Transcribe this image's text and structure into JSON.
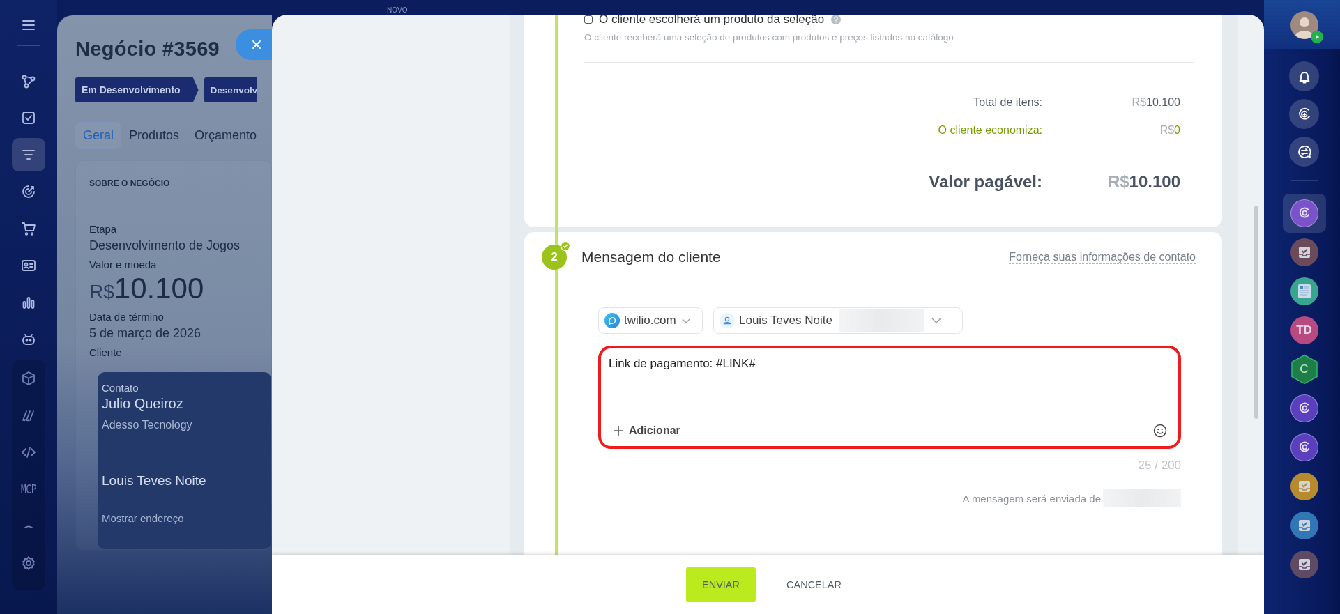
{
  "top_bar": {
    "label": "NOVO"
  },
  "left_nav": {
    "items": [
      {
        "kind": "icon",
        "selected": false
      },
      {
        "kind": "icon",
        "selected": false
      },
      {
        "kind": "icon",
        "selected": true
      },
      {
        "kind": "icon",
        "selected": false
      },
      {
        "kind": "icon",
        "selected": false
      },
      {
        "kind": "icon",
        "selected": false
      },
      {
        "kind": "icon",
        "selected": false
      },
      {
        "kind": "icon",
        "selected": false
      },
      {
        "kind": "icon",
        "selected": false
      },
      {
        "kind": "icon",
        "selected": false
      },
      {
        "kind": "icon",
        "selected": false
      },
      {
        "kind": "text",
        "label": "MCP",
        "selected": false
      },
      {
        "kind": "icon",
        "selected": false
      },
      {
        "kind": "icon",
        "selected": false
      }
    ]
  },
  "deal": {
    "title": "Negócio #3569",
    "stages": [
      "Em Desenvolvimento",
      "Desenvolv"
    ],
    "tabs": [
      {
        "label": "Geral",
        "selected": true
      },
      {
        "label": "Produtos",
        "selected": false
      },
      {
        "label": "Orçamento",
        "selected": false
      }
    ],
    "section_title": "SOBRE O NEGÓCIO",
    "fields": [
      {
        "kind": "text",
        "label": "Etapa",
        "value": "Desenvolvimento de Jogos"
      },
      {
        "kind": "money",
        "label": "Valor e moeda",
        "currency": "R$",
        "value": "10.100"
      },
      {
        "kind": "text",
        "label": "Data de término",
        "value": "5 de março de 2026"
      }
    ],
    "client_label": "Cliente",
    "contact": {
      "label": "Contato",
      "name": "Julio Queiroz",
      "company": "Adesso Tecnology",
      "second_name": "Louis Teves Noite",
      "address_link": "Mostrar endereço"
    }
  },
  "selection_option": {
    "label": "O cliente escolherá um produto da seleção",
    "checked": false,
    "description": "O cliente receberá uma seleção de produtos com produtos e preços listados no catálogo"
  },
  "totals": [
    {
      "kind": "normal",
      "label": "Total de itens:",
      "currency": "R$",
      "amount": "10.100"
    },
    {
      "kind": "savings",
      "label": "O cliente economiza:",
      "currency": "R$",
      "amount": "0"
    }
  ],
  "payable": {
    "label": "Valor pagável:",
    "currency": "R$",
    "amount": "10.100"
  },
  "message": {
    "step": "2",
    "done": true,
    "title": "Mensagem do cliente",
    "contact_link": "Forneça suas informações de contato",
    "channel": "twilio.com",
    "recipient": "Louis Teves Noite",
    "text": "Link de pagamento: #LINK#",
    "add_label": "Adicionar",
    "counter": "25 / 200",
    "sender_label": "A mensagem será enviada de"
  },
  "footer_buttons": [
    {
      "kind": "primary",
      "label": "ENVIAR"
    },
    {
      "kind": "plain",
      "label": "CANCELAR"
    }
  ],
  "right_rail": {
    "items": [
      {
        "kind": "avatar",
        "badge": true
      },
      {
        "kind": "tool"
      },
      {
        "kind": "tool"
      },
      {
        "kind": "tool"
      },
      {
        "kind": "swirl",
        "color": "#7a52c9",
        "selected": true
      },
      {
        "kind": "task",
        "color": "#6b4a5a",
        "selected": false
      },
      {
        "kind": "doc",
        "color": "#3aa58f",
        "selected": false
      },
      {
        "kind": "initials",
        "label": "TD",
        "color": "#b84a82",
        "selected": false
      },
      {
        "kind": "hexagon",
        "label": "C",
        "color": "#1f7d48",
        "selected": false
      },
      {
        "kind": "swirl",
        "color": "#5a3fbf",
        "selected": false
      },
      {
        "kind": "swirl",
        "color": "#5a3fbf",
        "selected": false
      },
      {
        "kind": "task",
        "color": "#b88a2e",
        "selected": false
      },
      {
        "kind": "task",
        "color": "#3277b5",
        "selected": false
      },
      {
        "kind": "task",
        "color": "#5e4a63",
        "selected": false
      }
    ]
  }
}
